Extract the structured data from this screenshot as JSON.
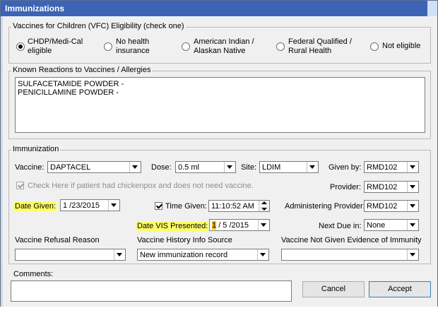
{
  "window": {
    "title": "Immunizations"
  },
  "vfc": {
    "title": "Vaccines for Children (VFC) Eligibility (check one)",
    "options": [
      {
        "line1": "CHDP/Medi-Cal",
        "line2": "eligible",
        "selected": true
      },
      {
        "line1": "No health",
        "line2": "insurance",
        "selected": false
      },
      {
        "line1": "American Indian /",
        "line2": "Alaskan Native",
        "selected": false
      },
      {
        "line1": "Federal Qualified /",
        "line2": "Rural Health",
        "selected": false
      },
      {
        "line1": "Not eligible",
        "line2": "",
        "selected": false
      }
    ]
  },
  "reactions": {
    "title": "Known Reactions to Vaccines / Allergies",
    "lines": [
      "SULFACETAMIDE POWDER -",
      "PENICILLAMINE POWDER -"
    ]
  },
  "immunization": {
    "title": "Immunization",
    "vaccine_label": "Vaccine:",
    "vaccine_value": "DAPTACEL",
    "dose_label": "Dose:",
    "dose_value": "0.5 ml",
    "site_label": "Site:",
    "site_value": "LDIM",
    "given_by_label": "Given by:",
    "given_by_value": "RMD102",
    "chickenpox_label": "Check Here if patient had chickenpox and does not need vaccine.",
    "provider_label": "Provider:",
    "provider_value": "RMD102",
    "date_given_label": "Date Given:",
    "date_given_value": "1 /23/2015",
    "time_given_label": "Time Given:",
    "time_given_value": "11:10:52 AM",
    "admin_provider_label": "Administering Provider:",
    "admin_provider_value": "RMD102",
    "vis_label": "Date VIS Presented:",
    "vis_month": "1",
    "vis_rest": "/ 5 /2015",
    "next_due_label": "Next Due in:",
    "next_due_value": "None",
    "refusal_label": "Vaccine Refusal Reason",
    "refusal_value": "",
    "history_label": "Vaccine History Info Source",
    "history_value": "New immunization record",
    "not_given_label": "Vaccine Not Given Evidence of Immunity",
    "not_given_value": ""
  },
  "comments_label": "Comments:",
  "buttons": {
    "cancel": "Cancel",
    "accept": "Accept"
  },
  "colors": {
    "titlebar": "#3c63b5",
    "highlight": "#ffff66"
  }
}
